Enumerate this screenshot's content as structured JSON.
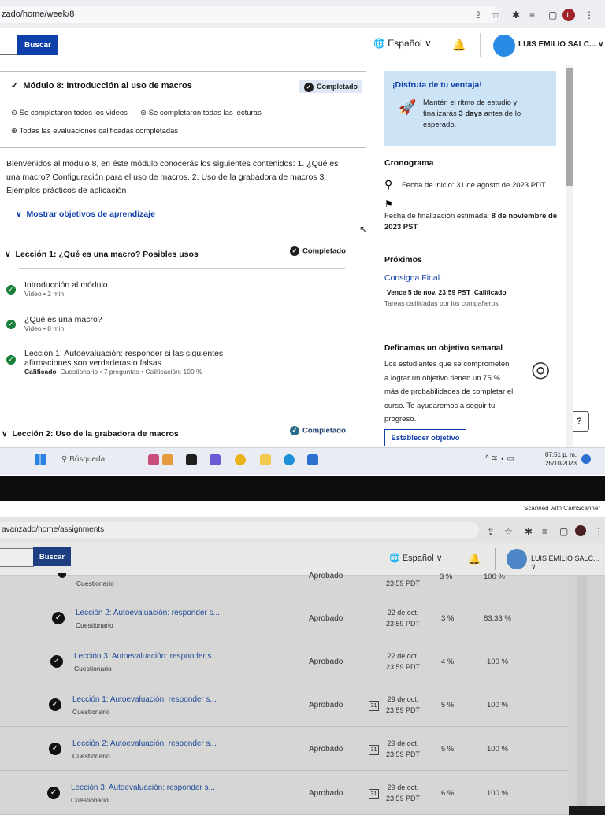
{
  "top": {
    "url": "zado/home/week/8",
    "search_button": "Buscar",
    "language": "Español",
    "user_name": "LUIS EMILIO SALC...",
    "user_initial": "L",
    "module": {
      "title": "Módulo 8: Introducción al uso de macros",
      "badge": "Completado",
      "stat_videos": "Se completaron todos los videos",
      "stat_readings": "Se completaron todas las lecturas",
      "stat_graded": "Todas las evaluaciones calificadas completadas"
    },
    "description": "Bienvenidos al módulo 8, en éste módulo conocerás los siguientes contenidos: 1. ¿Qué es una macro? Configuración para el uso de macros. 2. Uso de la grabadora de macros 3. Ejemplos prácticos de aplicación",
    "show_objectives": "Mostrar objetivos de aprendizaje",
    "lesson1": {
      "title": "Lección 1: ¿Qué es una macro? Posibles usos",
      "badge": "Completado",
      "items": [
        {
          "title": "Introducción al módulo",
          "meta": "Video • 2 min"
        },
        {
          "title": "¿Qué es una macro?",
          "meta": "Video • 8 min"
        },
        {
          "title": "Lección 1: Autoevaluación: responder si las siguientes",
          "title2": "afirmaciones son verdaderas o falsas",
          "graded": "Calificado",
          "meta": "Cuestionario • 7 preguntas • Calificación: 100 %"
        }
      ]
    },
    "lesson2": {
      "title": "Lección 2: Uso de la grabadora de macros",
      "badge": "Completado"
    },
    "sidebar": {
      "promo_title": "¡Disfruta de tu ventaja!",
      "promo_text1": "Mantén el ritmo de estudio y",
      "promo_text2_a": "finalizarás ",
      "promo_text2_b": "3 days",
      "promo_text2_c": " antes de lo",
      "promo_text3": "esperado.",
      "schedule_heading": "Cronograma",
      "start_date": "Fecha de inicio: 31 de agosto de 2023 PDT",
      "end_label": "Fecha de finalización estimada: ",
      "end_value": "8 de noviembre de",
      "end_value2": "2023 PST",
      "upcoming_heading": "Próximos",
      "upcoming_link": "Consigna Final.",
      "upcoming_due": "Vence 5 de nov. 23:59 PST",
      "upcoming_graded": "Calificado",
      "upcoming_peer": "Tareas calificadas por los compañeros",
      "goal_heading": "Definamos un objetivo semanal",
      "goal_lines": [
        "Los estudiantes que se comprometen",
        "a lograr un objetivo tienen un 75 %",
        "más de probabilidades de completar el",
        "curso. Te ayudaremos a seguir tu",
        "progreso."
      ],
      "goal_button": "Establecer objetivo"
    },
    "taskbar": {
      "search": "Búsqueda",
      "time": "07:51 p. m.",
      "date": "26/10/2023"
    }
  },
  "scanned_text": "Scanned with CamScanner",
  "bottom": {
    "url": "avanzado/home/assignments",
    "search_button": "Buscar",
    "language": "Español",
    "user_name": "LUIS EMILIO SALC...",
    "partial_row": {
      "status": "Aprobado",
      "date_time": "23:59 PDT",
      "weight": "3 %",
      "grade": "100 %",
      "sub": "Cuestionario"
    },
    "rows": [
      {
        "title": "Lección 2: Autoevaluación: responder s...",
        "sub": "Cuestionario",
        "status": "Aprobado",
        "cal": "",
        "date": "22 de oct.",
        "time": "23:59 PDT",
        "weight": "3 %",
        "grade": "83,33 %"
      },
      {
        "title": "Lección 3: Autoevaluación: responder s...",
        "sub": "Cuestionario",
        "status": "Aprobado",
        "cal": "",
        "date": "22 de oct.",
        "time": "23:59 PDT",
        "weight": "4 %",
        "grade": "100 %"
      },
      {
        "title": "Lección 1: Autoevaluación: responder s...",
        "sub": "Cuestionario",
        "status": "Aprobado",
        "cal": "31",
        "date": "29 de oct.",
        "time": "23:59 PDT",
        "weight": "5 %",
        "grade": "100 %"
      },
      {
        "title": "Lección 2: Autoevaluación: responder s...",
        "sub": "Cuestionario",
        "status": "Aprobado",
        "cal": "31",
        "date": "29 de oct.",
        "time": "23:59 PDT",
        "weight": "5 %",
        "grade": "100 %"
      },
      {
        "title": "Lección 3: Autoevaluación: responder s...",
        "sub": "Cuestionario",
        "status": "Aprobado",
        "cal": "31",
        "date": "29 de oct.",
        "time": "23:59 PDT",
        "weight": "6 %",
        "grade": "100 %"
      }
    ]
  },
  "colors": {
    "brand_blue": "#0f3fa8",
    "success_green": "#1a7f3a",
    "promo_bg": "#cde3f6"
  }
}
